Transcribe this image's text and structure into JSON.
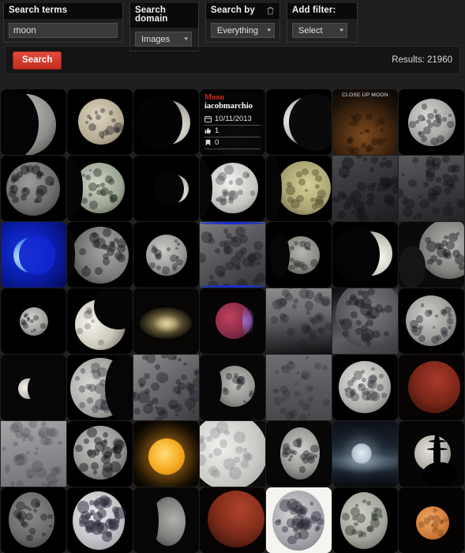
{
  "search_panel": {
    "fields": [
      {
        "label": "Search terms",
        "type": "text",
        "value": "moon",
        "placeholder": ""
      },
      {
        "label": "Search domain",
        "type": "select",
        "value": "Images"
      },
      {
        "label": "Search by",
        "type": "select",
        "value": "Everything",
        "icon": "trash-icon"
      },
      {
        "label": "Add filter:",
        "type": "select",
        "value": "Select"
      }
    ]
  },
  "action_bar": {
    "search_label": "Search",
    "results_label": "Results: 21960"
  },
  "colors": {
    "accent_red": "#cc2b1d",
    "panel_bg": "#1f1f1f",
    "label_bg": "#0a0a0a",
    "input_bg": "#3a3a3a"
  },
  "overlay_card": {
    "title": "Moon",
    "author": "iacobmarchio",
    "date": "10/11/2013",
    "likes": "1",
    "bookmarks": "0",
    "date_icon": "calendar-icon",
    "likes_icon": "thumbs-up-icon",
    "bookmarks_icon": "bookmark-icon"
  },
  "grid": {
    "columns": 7,
    "items": [
      {
        "id": 1,
        "style": "crescent-left-large",
        "caption": ""
      },
      {
        "id": 2,
        "style": "gibbous-tan",
        "caption": ""
      },
      {
        "id": 3,
        "style": "crescent-thin-right",
        "caption": ""
      },
      {
        "id": 4,
        "style": "overlay-card",
        "caption": ""
      },
      {
        "id": 5,
        "style": "sliver-crescent",
        "caption": ""
      },
      {
        "id": 6,
        "style": "closeup-brown",
        "caption": "CLOSE UP MOON"
      },
      {
        "id": 7,
        "style": "full-gray-small",
        "caption": ""
      },
      {
        "id": 8,
        "style": "full-gray-dark",
        "caption": ""
      },
      {
        "id": 9,
        "style": "gibbous-green",
        "caption": ""
      },
      {
        "id": 10,
        "style": "crescent-small-right",
        "caption": ""
      },
      {
        "id": 11,
        "style": "gibbous-bright",
        "caption": ""
      },
      {
        "id": 12,
        "style": "gibbous-olive",
        "caption": ""
      },
      {
        "id": 13,
        "style": "surface-craters",
        "caption": ""
      },
      {
        "id": 14,
        "style": "surface-craters-2",
        "caption": ""
      },
      {
        "id": 15,
        "style": "blue-crescent",
        "caption": ""
      },
      {
        "id": 16,
        "style": "half-gray-left",
        "caption": ""
      },
      {
        "id": 17,
        "style": "full-small-gray",
        "caption": ""
      },
      {
        "id": 18,
        "style": "surface-fill-blue-edge",
        "caption": ""
      },
      {
        "id": 19,
        "style": "gibbous-small-gray",
        "caption": ""
      },
      {
        "id": 20,
        "style": "crescent-bright-right",
        "caption": ""
      },
      {
        "id": 21,
        "style": "half-gray-right",
        "caption": ""
      },
      {
        "id": 22,
        "style": "full-tiny-gray",
        "caption": ""
      },
      {
        "id": 23,
        "style": "half-bright-diag",
        "caption": ""
      },
      {
        "id": 24,
        "style": "dust-cloud-tan",
        "caption": ""
      },
      {
        "id": 25,
        "style": "eclipse-red-purple",
        "caption": ""
      },
      {
        "id": 26,
        "style": "surface-gray-grad",
        "caption": ""
      },
      {
        "id": 27,
        "style": "surface-gray-large",
        "caption": ""
      },
      {
        "id": 28,
        "style": "full-gray-med",
        "caption": ""
      },
      {
        "id": 29,
        "style": "half-tiny-bright",
        "caption": ""
      },
      {
        "id": 30,
        "style": "gibbous-left-big",
        "caption": ""
      },
      {
        "id": 31,
        "style": "terminator-craters",
        "caption": ""
      },
      {
        "id": 32,
        "style": "half-small-gray",
        "caption": ""
      },
      {
        "id": 33,
        "style": "surface-flat-gray",
        "caption": ""
      },
      {
        "id": 34,
        "style": "full-bright-gray",
        "caption": ""
      },
      {
        "id": 35,
        "style": "eclipse-dark-red",
        "caption": ""
      },
      {
        "id": 36,
        "style": "surface-fill-lightgray",
        "caption": ""
      },
      {
        "id": 37,
        "style": "full-gray-craters",
        "caption": ""
      },
      {
        "id": 38,
        "style": "golden-full",
        "caption": ""
      },
      {
        "id": 39,
        "style": "bright-gibbous-fill",
        "caption": ""
      },
      {
        "id": 40,
        "style": "gibbous-right-gray",
        "caption": ""
      },
      {
        "id": 41,
        "style": "moon-clouds",
        "caption": ""
      },
      {
        "id": 42,
        "style": "silhouette-tower",
        "caption": ""
      },
      {
        "id": 43,
        "style": "full-dim-gray",
        "caption": ""
      },
      {
        "id": 44,
        "style": "full-detailed-bright",
        "caption": ""
      },
      {
        "id": 45,
        "style": "half-dim-right",
        "caption": ""
      },
      {
        "id": 46,
        "style": "eclipse-rust",
        "caption": ""
      },
      {
        "id": 47,
        "style": "white-bg-moon",
        "caption": ""
      },
      {
        "id": 48,
        "style": "full-greenish-gray",
        "caption": ""
      },
      {
        "id": 49,
        "style": "orange-full-small",
        "caption": ""
      }
    ]
  }
}
